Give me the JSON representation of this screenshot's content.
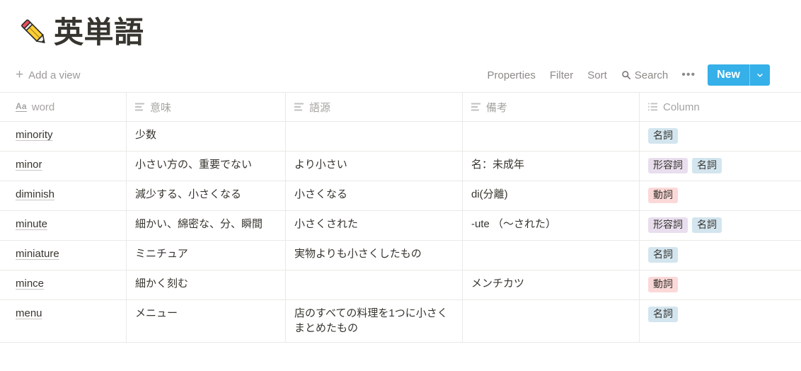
{
  "page": {
    "emoji": "pencil-emoji",
    "title": "英単語"
  },
  "toolbar": {
    "add_view_label": "Add a view",
    "plus_icon": "plus-icon",
    "properties_label": "Properties",
    "filter_label": "Filter",
    "sort_label": "Sort",
    "search_label": "Search",
    "search_icon": "search-icon",
    "more_label": "•••",
    "new_label": "New",
    "new_caret_icon": "chevron-down-icon",
    "accent_color": "#35b0e8"
  },
  "table": {
    "columns": [
      {
        "label": "word",
        "icon": "title-aa-icon"
      },
      {
        "label": "意味",
        "icon": "text-lines-icon"
      },
      {
        "label": "語源",
        "icon": "text-lines-icon"
      },
      {
        "label": "備考",
        "icon": "text-lines-icon"
      },
      {
        "label": "Column",
        "icon": "multi-select-list-icon"
      }
    ],
    "tag_colors": {
      "名詞": "#d3e5ef",
      "形容詞": "#e8deee",
      "動詞": "#fbd9d8"
    },
    "rows": [
      {
        "word": "minority",
        "meaning": "少数",
        "origin": "",
        "note": "",
        "tags": [
          "名詞"
        ]
      },
      {
        "word": "minor",
        "meaning": "小さい方の、重要でない",
        "origin": "より小さい",
        "note": "名：未成年",
        "tags": [
          "形容詞",
          "名詞"
        ]
      },
      {
        "word": "diminish",
        "meaning": "減少する、小さくなる",
        "origin": "小さくなる",
        "note": "di(分離)",
        "tags": [
          "動詞"
        ]
      },
      {
        "word": "minute",
        "meaning": "細かい、綿密な、分、瞬間",
        "origin": "小さくされた",
        "note": "-ute （〜された）",
        "tags": [
          "形容詞",
          "名詞"
        ]
      },
      {
        "word": "miniature",
        "meaning": "ミニチュア",
        "origin": "実物よりも小さくしたもの",
        "note": "",
        "tags": [
          "名詞"
        ]
      },
      {
        "word": "mince",
        "meaning": "細かく刻む",
        "origin": "",
        "note": "メンチカツ",
        "tags": [
          "動詞"
        ]
      },
      {
        "word": "menu",
        "meaning": "メニュー",
        "origin": "店のすべての料理を1つに小さくまとめたもの",
        "note": "",
        "tags": [
          "名詞"
        ]
      }
    ]
  }
}
